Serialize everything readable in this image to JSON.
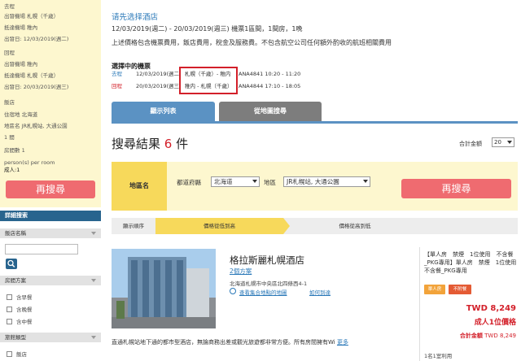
{
  "sidebar": {
    "summary": {
      "outbound_label": "去程",
      "outbound_depart": "出發機場 札幌（千歲）",
      "outbound_arrive": "抵達機場 稚內",
      "outbound_date": "出發日: 12/03/2019(週二)",
      "return_label": "回程",
      "return_depart": "出發機場 稚內",
      "return_arrive": "抵達機場 札幌（千歲）",
      "return_date": "出發日: 20/03/2019(週三)",
      "hotel_label": "飯店",
      "pref": "住宿地 北海道",
      "area": "地區名 JR札幌站, 大通公園",
      "rooms": "1 間",
      "nights": "房間數 1",
      "persons_label": "person(s) per room",
      "adults": "成人:1"
    },
    "research_button": "再搜尋",
    "detail_search_header": "詳細搜索",
    "hotel_name_header": "飯店名稱",
    "room_plan_header": "房間方案",
    "meal_options": [
      "含早餐",
      "含晚餐",
      "含中餐"
    ],
    "facility_header": "旅館類型",
    "facility_options": [
      "飯店"
    ]
  },
  "main": {
    "page_title": "请先选择酒店",
    "trip_info": "12/03/2019(週二) - 20/03/2019(週三) 機票1區間，1間房，1晚",
    "price_note": "上述價格包含機票費用，飯店費用，稅金及服務費。不包含航空公司任何額外酌收的航班相關費用",
    "selected_flights_label": "選擇中的機票",
    "flights": [
      {
        "dir": "去程",
        "date": "12/03/2019(週二)",
        "route": "札幌（千歲）- 稚内",
        "flight": "ANA4841 10:20 - 11:20",
        "color": "#2a78b8"
      },
      {
        "dir": "回程",
        "date": "20/03/2019(週三)",
        "route": "稚内 - 札幌（千歲）",
        "flight": "ANA4844 17:10 - 18:05",
        "color": "#d3202a"
      }
    ],
    "tabs": {
      "list": "顯示列表",
      "map": "從地圖搜尋"
    },
    "results": {
      "prefix": "搜尋結果 ",
      "count": "6",
      "suffix": " 件"
    },
    "sort_label": "合計金額",
    "sort_select": "20",
    "area_search": {
      "label": "地區名",
      "pref_label": "都道府縣",
      "pref_value": "北海道",
      "area_label": "地區",
      "area_value": "JR札幌站, 大通公園",
      "button": "再搜尋"
    },
    "sort_bar": {
      "label": "顯示順序",
      "low": "價格從低到高",
      "high": "價格從高到低"
    },
    "hotel": {
      "name": "格拉斯麗札幌酒店",
      "plans": "2個方案",
      "address": "北海道札幌市中央區北四條西4-1",
      "map_link": "查看集合地點的地圖",
      "howto_link": "如何到達",
      "description": "直通札幌站地下通的都市型酒店，無論商務出差或觀光旅遊都非常方便。所有房間擁有Wi",
      "more": "更多",
      "room_type": "【單人房　禁煙　1位使用　不含餐_PKG專用】單人房　禁煙　1位使用　不含餐_PKG專用",
      "badge_single": "單人房",
      "badge_nonref": "不附餐",
      "price": "TWD 8,249",
      "price_per": "成人1位價格",
      "total_label": "合計金額",
      "total_value": "TWD 8,249",
      "rooms_used": "1名1室利用"
    }
  },
  "colors": {
    "accent_blue": "#2a78b8",
    "accent_red": "#d3202a",
    "button_pink": "#ef6b70",
    "highlight_yellow": "#f7d95b"
  }
}
